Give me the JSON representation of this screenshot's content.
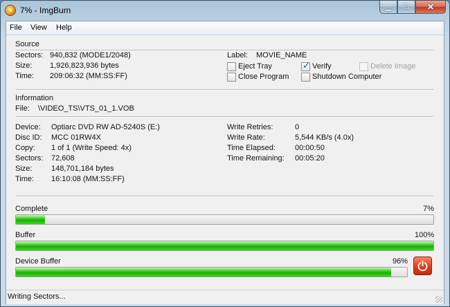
{
  "window": {
    "title": "7% - ImgBurn"
  },
  "menu": {
    "items": [
      "File",
      "View",
      "Help"
    ]
  },
  "source": {
    "heading": "Source",
    "sectors_label": "Sectors:",
    "sectors_value": "940,832 (MODE1/2048)",
    "size_label": "Size:",
    "size_value": "1,926,823,936 bytes",
    "time_label": "Time:",
    "time_value": "209:06:32 (MM:SS:FF)",
    "label_label": "Label:",
    "label_value": "MOVIE_NAME",
    "options": {
      "eject_tray": {
        "label": "Eject Tray",
        "checked": false
      },
      "verify": {
        "label": "Verify",
        "checked": true
      },
      "delete_image": {
        "label": "Delete Image",
        "checked": false,
        "disabled": true
      },
      "close_program": {
        "label": "Close Program",
        "checked": false
      },
      "shutdown_computer": {
        "label": "Shutdown Computer",
        "checked": false
      }
    }
  },
  "information": {
    "heading": "Information",
    "file_label": "File:",
    "file_value": "\\VIDEO_TS\\VTS_01_1.VOB",
    "device_label": "Device:",
    "device_value": "Optiarc DVD RW AD-5240S (E:)",
    "disc_id_label": "Disc ID:",
    "disc_id_value": "MCC 01RW4X",
    "copy_label": "Copy:",
    "copy_value": "1 of 1 (Write Speed: 4x)",
    "sectors_label": "Sectors:",
    "sectors_value": "72,608",
    "size_label": "Size:",
    "size_value": "148,701,184 bytes",
    "time_label": "Time:",
    "time_value": "16:10:08 (MM:SS:FF)",
    "write_retries_label": "Write Retries:",
    "write_retries_value": "0",
    "write_rate_label": "Write Rate:",
    "write_rate_value": "5,544 KB/s (4.0x)",
    "time_elapsed_label": "Time Elapsed:",
    "time_elapsed_value": "00:00:50",
    "time_remaining_label": "Time Remaining:",
    "time_remaining_value": "00:05:20"
  },
  "progress": {
    "complete": {
      "label": "Complete",
      "percent_text": "7%",
      "percent": 7
    },
    "buffer": {
      "label": "Buffer",
      "percent_text": "100%",
      "percent": 100
    },
    "device_buffer": {
      "label": "Device Buffer",
      "percent_text": "96%",
      "percent": 96
    }
  },
  "status": {
    "text": "Writing Sectors..."
  },
  "icons": {
    "app": "imgburn-disc-icon",
    "power": "power-icon"
  }
}
